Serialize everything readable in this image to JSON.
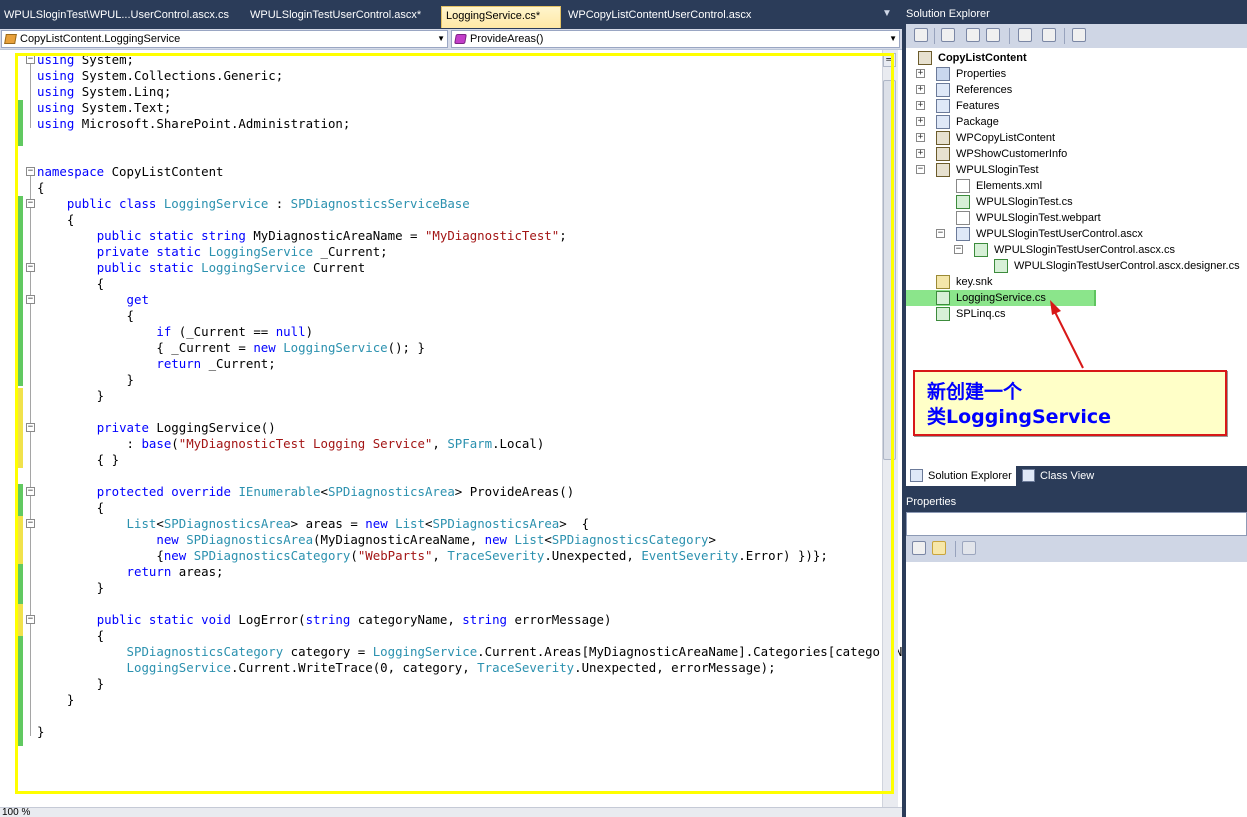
{
  "tabs": [
    {
      "label": "WPULSloginTest\\WPUL...UserControl.ascx.cs",
      "active": false
    },
    {
      "label": "WPULSloginTestUserControl.ascx*",
      "active": false
    },
    {
      "label": "LoggingService.cs*",
      "active": true
    },
    {
      "label": "WPCopyListContentUserControl.ascx",
      "active": false
    }
  ],
  "navbar": {
    "type_combo": "CopyListContent.LoggingService",
    "member_combo": "ProvideAreas()"
  },
  "code_lines": [
    [
      [
        "kw",
        "using"
      ],
      [
        "t",
        " System;"
      ]
    ],
    [
      [
        "kw",
        "using"
      ],
      [
        "t",
        " System.Collections.Generic;"
      ]
    ],
    [
      [
        "kw",
        "using"
      ],
      [
        "t",
        " System.Linq;"
      ]
    ],
    [
      [
        "kw",
        "using"
      ],
      [
        "t",
        " System.Text;"
      ]
    ],
    [
      [
        "kw",
        "using"
      ],
      [
        "t",
        " Microsoft.SharePoint.Administration;"
      ]
    ],
    [],
    [],
    [
      [
        "kw",
        "namespace"
      ],
      [
        "t",
        " CopyListContent"
      ]
    ],
    [
      [
        "t",
        "{"
      ]
    ],
    [
      [
        "t",
        "    "
      ],
      [
        "kw",
        "public class"
      ],
      [
        "t",
        " "
      ],
      [
        "ty",
        "LoggingService"
      ],
      [
        "t",
        " : "
      ],
      [
        "ty",
        "SPDiagnosticsServiceBase"
      ]
    ],
    [
      [
        "t",
        "    {"
      ]
    ],
    [
      [
        "t",
        "        "
      ],
      [
        "kw",
        "public static string"
      ],
      [
        "t",
        " MyDiagnosticAreaName = "
      ],
      [
        "st",
        "\"MyDiagnosticTest\""
      ],
      [
        "t",
        ";"
      ]
    ],
    [
      [
        "t",
        "        "
      ],
      [
        "kw",
        "private static"
      ],
      [
        "t",
        " "
      ],
      [
        "ty",
        "LoggingService"
      ],
      [
        "t",
        " _Current;"
      ]
    ],
    [
      [
        "t",
        "        "
      ],
      [
        "kw",
        "public static"
      ],
      [
        "t",
        " "
      ],
      [
        "ty",
        "LoggingService"
      ],
      [
        "t",
        " Current"
      ]
    ],
    [
      [
        "t",
        "        {"
      ]
    ],
    [
      [
        "t",
        "            "
      ],
      [
        "kw",
        "get"
      ]
    ],
    [
      [
        "t",
        "            {"
      ]
    ],
    [
      [
        "t",
        "                "
      ],
      [
        "kw",
        "if"
      ],
      [
        "t",
        " (_Current == "
      ],
      [
        "kw",
        "null"
      ],
      [
        "t",
        ")"
      ]
    ],
    [
      [
        "t",
        "                { _Current = "
      ],
      [
        "kw",
        "new"
      ],
      [
        "t",
        " "
      ],
      [
        "ty",
        "LoggingService"
      ],
      [
        "t",
        "(); }"
      ]
    ],
    [
      [
        "t",
        "                "
      ],
      [
        "kw",
        "return"
      ],
      [
        "t",
        " _Current;"
      ]
    ],
    [
      [
        "t",
        "            }"
      ]
    ],
    [
      [
        "t",
        "        }"
      ]
    ],
    [],
    [
      [
        "t",
        "        "
      ],
      [
        "kw",
        "private"
      ],
      [
        "t",
        " LoggingService()"
      ]
    ],
    [
      [
        "t",
        "            : "
      ],
      [
        "kw",
        "base"
      ],
      [
        "t",
        "("
      ],
      [
        "st",
        "\"MyDiagnosticTest Logging Service\""
      ],
      [
        "t",
        ", "
      ],
      [
        "ty",
        "SPFarm"
      ],
      [
        "t",
        ".Local)"
      ]
    ],
    [
      [
        "t",
        "        { }"
      ]
    ],
    [],
    [
      [
        "t",
        "        "
      ],
      [
        "kw",
        "protected override"
      ],
      [
        "t",
        " "
      ],
      [
        "ty",
        "IEnumerable"
      ],
      [
        "t",
        "<"
      ],
      [
        "ty",
        "SPDiagnosticsArea"
      ],
      [
        "t",
        "> ProvideAreas()"
      ]
    ],
    [
      [
        "t",
        "        {"
      ]
    ],
    [
      [
        "t",
        "            "
      ],
      [
        "ty",
        "List"
      ],
      [
        "t",
        "<"
      ],
      [
        "ty",
        "SPDiagnosticsArea"
      ],
      [
        "t",
        "> areas = "
      ],
      [
        "kw",
        "new"
      ],
      [
        "t",
        " "
      ],
      [
        "ty",
        "List"
      ],
      [
        "t",
        "<"
      ],
      [
        "ty",
        "SPDiagnosticsArea"
      ],
      [
        "t",
        ">  {"
      ]
    ],
    [
      [
        "t",
        "                "
      ],
      [
        "kw",
        "new"
      ],
      [
        "t",
        " "
      ],
      [
        "ty",
        "SPDiagnosticsArea"
      ],
      [
        "t",
        "(MyDiagnosticAreaName, "
      ],
      [
        "kw",
        "new"
      ],
      [
        "t",
        " "
      ],
      [
        "ty",
        "List"
      ],
      [
        "t",
        "<"
      ],
      [
        "ty",
        "SPDiagnosticsCategory"
      ],
      [
        "t",
        ">"
      ]
    ],
    [
      [
        "t",
        "                {"
      ],
      [
        "kw",
        "new"
      ],
      [
        "t",
        " "
      ],
      [
        "ty",
        "SPDiagnosticsCategory"
      ],
      [
        "t",
        "("
      ],
      [
        "st",
        "\"WebParts\""
      ],
      [
        "t",
        ", "
      ],
      [
        "ty",
        "TraceSeverity"
      ],
      [
        "t",
        ".Unexpected, "
      ],
      [
        "ty",
        "EventSeverity"
      ],
      [
        "t",
        ".Error) })};"
      ]
    ],
    [
      [
        "t",
        "            "
      ],
      [
        "kw",
        "return"
      ],
      [
        "t",
        " areas;"
      ]
    ],
    [
      [
        "t",
        "        }"
      ]
    ],
    [],
    [
      [
        "t",
        "        "
      ],
      [
        "kw",
        "public static void"
      ],
      [
        "t",
        " LogError("
      ],
      [
        "kw",
        "string"
      ],
      [
        "t",
        " categoryName, "
      ],
      [
        "kw",
        "string"
      ],
      [
        "t",
        " errorMessage)"
      ]
    ],
    [
      [
        "t",
        "        {"
      ]
    ],
    [
      [
        "t",
        "            "
      ],
      [
        "ty",
        "SPDiagnosticsCategory"
      ],
      [
        "t",
        " category = "
      ],
      [
        "ty",
        "LoggingService"
      ],
      [
        "t",
        ".Current.Areas[MyDiagnosticAreaName].Categories[categoryName];"
      ]
    ],
    [
      [
        "t",
        "            "
      ],
      [
        "ty",
        "LoggingService"
      ],
      [
        "t",
        ".Current.WriteTrace(0, category, "
      ],
      [
        "ty",
        "TraceSeverity"
      ],
      [
        "t",
        ".Unexpected, errorMessage);"
      ]
    ],
    [
      [
        "t",
        "        }"
      ]
    ],
    [
      [
        "t",
        "    }"
      ]
    ],
    [],
    [
      [
        "t",
        "}"
      ]
    ]
  ],
  "editor": {
    "zoom": "100 %"
  },
  "solution_explorer": {
    "title": "Solution Explorer",
    "nodes": [
      {
        "label": "CopyListContent",
        "depth": 0,
        "bold": true,
        "icon": "solution-icon",
        "expander": ""
      },
      {
        "label": "Properties",
        "depth": 1,
        "icon": "properties-icon",
        "expander": "+"
      },
      {
        "label": "References",
        "depth": 1,
        "icon": "references-icon",
        "expander": "+"
      },
      {
        "label": "Features",
        "depth": 1,
        "icon": "features-icon",
        "expander": "+"
      },
      {
        "label": "Package",
        "depth": 1,
        "icon": "package-icon",
        "expander": "+"
      },
      {
        "label": "WPCopyListContent",
        "depth": 1,
        "icon": "webpart-folder-icon",
        "expander": "+"
      },
      {
        "label": "WPShowCustomerInfo",
        "depth": 1,
        "icon": "webpart-folder-icon",
        "expander": "+"
      },
      {
        "label": "WPULSloginTest",
        "depth": 1,
        "icon": "webpart-folder-icon",
        "expander": "-"
      },
      {
        "label": "Elements.xml",
        "depth": 2,
        "icon": "xml-file-icon",
        "expander": ""
      },
      {
        "label": "WPULSloginTest.cs",
        "depth": 2,
        "icon": "cs-file-icon",
        "expander": ""
      },
      {
        "label": "WPULSloginTest.webpart",
        "depth": 2,
        "icon": "webpart-file-icon",
        "expander": ""
      },
      {
        "label": "WPULSloginTestUserControl.ascx",
        "depth": 2,
        "icon": "ascx-file-icon",
        "expander": "-"
      },
      {
        "label": "WPULSloginTestUserControl.ascx.cs",
        "depth": 3,
        "icon": "cs-file-icon",
        "expander": "-"
      },
      {
        "label": "WPULSloginTestUserControl.ascx.designer.cs",
        "depth": 4,
        "icon": "cs-file-icon",
        "expander": ""
      },
      {
        "label": "key.snk",
        "depth": 1,
        "icon": "key-file-icon",
        "expander": ""
      },
      {
        "label": "LoggingService.cs",
        "depth": 1,
        "icon": "cs-file-icon",
        "expander": "",
        "selected": true
      },
      {
        "label": "SPLinq.cs",
        "depth": 1,
        "icon": "cs-file-icon",
        "expander": ""
      }
    ]
  },
  "callout": {
    "text": "新创建一个\n类LoggingService"
  },
  "panel_tabs": [
    {
      "label": "Solution Explorer",
      "active": true
    },
    {
      "label": "Class View",
      "active": false
    }
  ],
  "properties": {
    "title": "Properties"
  },
  "colors": {
    "keyword": "#0000ff",
    "type": "#2b91af",
    "string": "#a31515",
    "highlight_border": "#ffff00",
    "selection": "#8be58b",
    "callout_border": "#d81818"
  }
}
